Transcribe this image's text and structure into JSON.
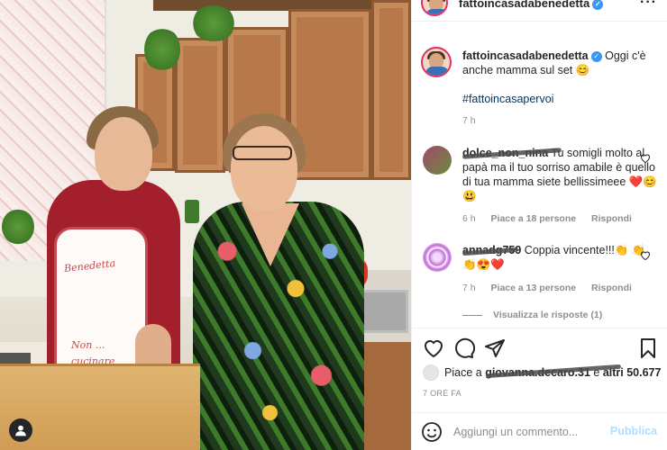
{
  "post": {
    "author": "fattoincasadabenedetta",
    "caption_text": "Oggi c'è anche mamma sul set 😊",
    "hashtag": "#fattoincasapervoi",
    "caption_time": "7 h"
  },
  "comments": [
    {
      "username": "dolce_non_nina",
      "text": "Tu somigli molto al papà ma il tuo sorriso amabile è quello di tua mamma siete bellissimeee ❤️😊😃",
      "time": "6 h",
      "likes": "Piace a 18 persone",
      "reply": "Rispondi"
    },
    {
      "username": "annadg759",
      "text": "Coppia vincente!!!👏 👏👏😍❤️",
      "time": "7 h",
      "likes": "Piace a 13 persone",
      "reply": "Rispondi"
    }
  ],
  "replies_toggle": "Visualizza le risposte (1)",
  "likes_summary": {
    "prefix": "Piace a",
    "user": "giovanna.decaro.31",
    "suffix": "e",
    "others": "altri 50.677"
  },
  "time_ago": "7 ORE FA",
  "comment_box": {
    "placeholder": "Aggiungi un commento...",
    "publish_label": "Pubblica"
  },
  "photo": {
    "apron_text_top": "Benedetta",
    "apron_text_bottom": "Non ... cucinare"
  },
  "icons": [
    "more-icon",
    "heart-icon",
    "comment-icon",
    "share-icon",
    "bookmark-icon",
    "emoji-icon",
    "user-tag-icon",
    "verified-icon"
  ],
  "colors": {
    "link": "#00376b",
    "muted": "#8e8e8e",
    "verified": "#3897f0",
    "publish": "#b2dffc",
    "heart": "#262626"
  }
}
